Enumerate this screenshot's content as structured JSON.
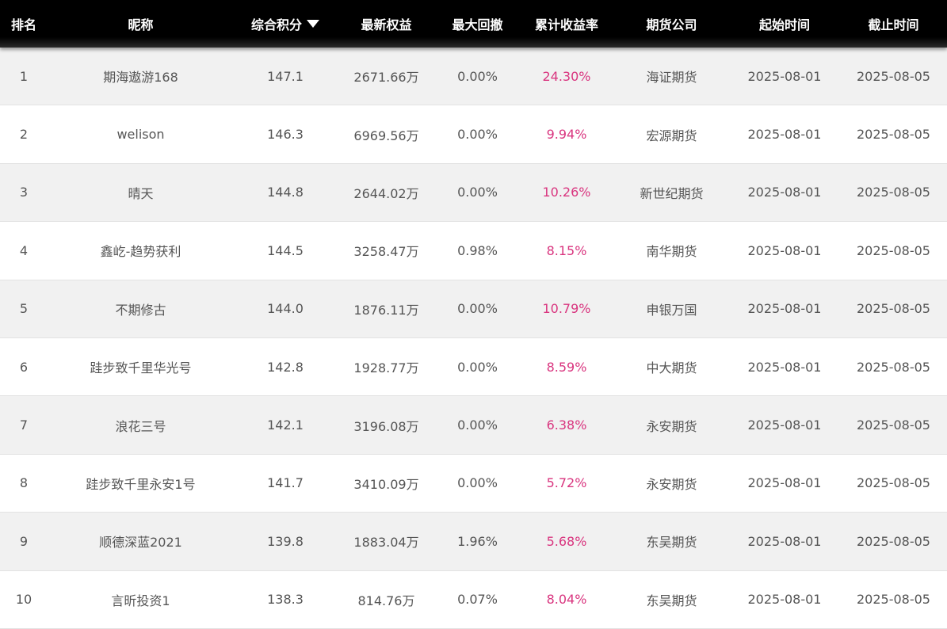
{
  "header": {
    "rank": "排名",
    "nickname": "昵称",
    "score": "综合积分",
    "equity": "最新权益",
    "drawdown": "最大回撤",
    "return": "累计收益率",
    "company": "期货公司",
    "start": "起始时间",
    "end": "截止时间",
    "sort_icon": "caret-down-icon"
  },
  "colors": {
    "header_bg": "#000000",
    "header_text": "#ffffff",
    "row_odd": "#f1f1f1",
    "row_even": "#ffffff",
    "positive": "#d9357f",
    "text": "#555555"
  },
  "rows": [
    {
      "rank": "1",
      "nickname": "期海遨游168",
      "score": "147.1",
      "equity": "2671.66万",
      "drawdown": "0.00%",
      "return": "24.30%",
      "company": "海证期货",
      "start": "2025-08-01",
      "end": "2025-08-05"
    },
    {
      "rank": "2",
      "nickname": "welison",
      "score": "146.3",
      "equity": "6969.56万",
      "drawdown": "0.00%",
      "return": "9.94%",
      "company": "宏源期货",
      "start": "2025-08-01",
      "end": "2025-08-05"
    },
    {
      "rank": "3",
      "nickname": "晴天",
      "score": "144.8",
      "equity": "2644.02万",
      "drawdown": "0.00%",
      "return": "10.26%",
      "company": "新世纪期货",
      "start": "2025-08-01",
      "end": "2025-08-05"
    },
    {
      "rank": "4",
      "nickname": "鑫屹-趋势获利",
      "score": "144.5",
      "equity": "3258.47万",
      "drawdown": "0.98%",
      "return": "8.15%",
      "company": "南华期货",
      "start": "2025-08-01",
      "end": "2025-08-05"
    },
    {
      "rank": "5",
      "nickname": "不期修古",
      "score": "144.0",
      "equity": "1876.11万",
      "drawdown": "0.00%",
      "return": "10.79%",
      "company": "申银万国",
      "start": "2025-08-01",
      "end": "2025-08-05"
    },
    {
      "rank": "6",
      "nickname": "跬步致千里华光号",
      "score": "142.8",
      "equity": "1928.77万",
      "drawdown": "0.00%",
      "return": "8.59%",
      "company": "中大期货",
      "start": "2025-08-01",
      "end": "2025-08-05"
    },
    {
      "rank": "7",
      "nickname": "浪花三号",
      "score": "142.1",
      "equity": "3196.08万",
      "drawdown": "0.00%",
      "return": "6.38%",
      "company": "永安期货",
      "start": "2025-08-01",
      "end": "2025-08-05"
    },
    {
      "rank": "8",
      "nickname": "跬步致千里永安1号",
      "score": "141.7",
      "equity": "3410.09万",
      "drawdown": "0.00%",
      "return": "5.72%",
      "company": "永安期货",
      "start": "2025-08-01",
      "end": "2025-08-05"
    },
    {
      "rank": "9",
      "nickname": "顺德深蓝2021",
      "score": "139.8",
      "equity": "1883.04万",
      "drawdown": "1.96%",
      "return": "5.68%",
      "company": "东吴期货",
      "start": "2025-08-01",
      "end": "2025-08-05"
    },
    {
      "rank": "10",
      "nickname": "言昕投资1",
      "score": "138.3",
      "equity": "814.76万",
      "drawdown": "0.07%",
      "return": "8.04%",
      "company": "东吴期货",
      "start": "2025-08-01",
      "end": "2025-08-05"
    }
  ]
}
